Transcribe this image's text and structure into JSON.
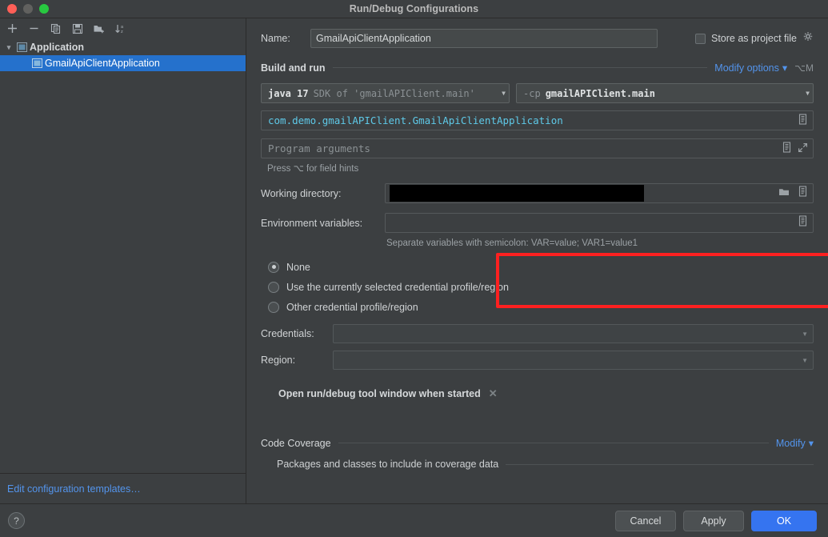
{
  "window": {
    "title": "Run/Debug Configurations",
    "traffic_lights": [
      "close",
      "minimize",
      "zoom"
    ]
  },
  "sidebar": {
    "toolbar": [
      {
        "name": "add-icon",
        "label": "Add New Configuration"
      },
      {
        "name": "remove-icon",
        "label": "Remove Configuration"
      },
      {
        "name": "copy-icon",
        "label": "Copy Configuration"
      },
      {
        "name": "save-icon",
        "label": "Save Configuration"
      },
      {
        "name": "new-folder-icon",
        "label": "Create New Folder"
      },
      {
        "name": "sort-alphabetically-icon",
        "label": "Sort Configurations"
      }
    ],
    "tree": [
      {
        "label": "Application",
        "type": "group",
        "expanded": true,
        "selected": false
      },
      {
        "label": "GmailApiClientApplication",
        "type": "item",
        "selected": true
      }
    ],
    "footer_link": "Edit configuration templates…"
  },
  "form": {
    "name_label": "Name:",
    "name_value": "GmailApiClientApplication",
    "store_as_project_file": {
      "label": "Store as project file",
      "checked": false,
      "gear_icon": "gear-icon"
    },
    "build_and_run": {
      "section_title": "Build and run",
      "modify_options_label": "Modify options",
      "modify_options_shortcut": "⌥M",
      "jdk_combo": {
        "primary": "java 17",
        "secondary": "SDK of 'gmailAPIClient.main'"
      },
      "classpath_combo": {
        "prefix": "-cp",
        "value": "gmailAPIClient.main"
      },
      "main_class": "com.demo.gmailAPIClient.GmailApiClientApplication",
      "program_arguments_placeholder": "Program arguments",
      "field_hint": "Press ⌥ for field hints"
    },
    "working_directory": {
      "label": "Working directory:",
      "value": "",
      "redacted": true
    },
    "environment_variables": {
      "label": "Environment variables:",
      "value": "",
      "hint": "Separate variables with semicolon: VAR=value; VAR1=value1",
      "highlighted": true,
      "highlight_color": "#fd2020"
    },
    "credential_options": [
      {
        "label": "None",
        "selected": true
      },
      {
        "label": "Use the currently selected credential profile/region",
        "selected": false
      },
      {
        "label": "Other credential profile/region",
        "selected": false
      }
    ],
    "credentials": {
      "label": "Credentials:",
      "value": ""
    },
    "region": {
      "label": "Region:",
      "value": ""
    },
    "open_tool_window": {
      "label": "Open run/debug tool window when started",
      "remove_icon": "close-icon"
    },
    "code_coverage": {
      "section_title": "Code Coverage",
      "modify_label": "Modify",
      "subsection_title": "Packages and classes to include in coverage data"
    }
  },
  "footer": {
    "help_label": "?",
    "buttons": [
      {
        "label": "Cancel",
        "primary": false
      },
      {
        "label": "Apply",
        "primary": false
      },
      {
        "label": "OK",
        "primary": true
      }
    ]
  },
  "colors": {
    "background": "#3c3f41",
    "selection": "#2571cc",
    "link": "#5394ec",
    "primary_button": "#3574f0",
    "annotation": "#fd2020",
    "code_text": "#5ec9e8"
  }
}
